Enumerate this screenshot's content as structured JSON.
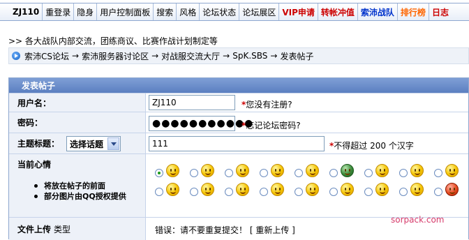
{
  "topnav": {
    "items": [
      {
        "label": "ZJ110",
        "color": "#000000"
      },
      {
        "label": "重登录",
        "color": "#000000"
      },
      {
        "label": "隐身",
        "color": "#000000"
      },
      {
        "label": "用户控制面板",
        "color": "#000000"
      },
      {
        "label": "搜索",
        "color": "#000000"
      },
      {
        "label": "风格",
        "color": "#000000"
      },
      {
        "label": "论坛状态",
        "color": "#000000"
      },
      {
        "label": "论坛展区",
        "color": "#000000"
      },
      {
        "label": "VIP申请",
        "color": "#cc0000"
      },
      {
        "label": "转帐冲值",
        "color": "#cc0000"
      },
      {
        "label": "索沛战队",
        "color": "#0033cc"
      },
      {
        "label": "排行榜",
        "color": "#ff6600"
      },
      {
        "label": "日志",
        "color": "#cc0000"
      }
    ]
  },
  "notice": ">> 各大战队内部交流，团练商议、比赛作战计划制定等",
  "breadcrumb": {
    "items": [
      "索沛CS论坛",
      "索沛服务器讨论区",
      "对战服交流大厅",
      "SpK.SBS",
      "发表帖子"
    ],
    "separator": "→"
  },
  "form": {
    "header": "发表帖子",
    "username": {
      "label": "用户名：",
      "value": "ZJ110",
      "required_mark": "*",
      "hint": "您没有注册?"
    },
    "password": {
      "label": "密码：",
      "value": "●●●●●●●●●●●",
      "required_mark": "*",
      "hint": "忘记论坛密码?"
    },
    "subject": {
      "label": "主题标题：",
      "topic_select": "选择话题",
      "value": "111",
      "required_mark": "*",
      "hint": "不得超过 200 个汉字"
    },
    "mood": {
      "label": "当前心情",
      "tips": [
        "将放在帖子的前面",
        "部分图片由QQ授权提供"
      ],
      "selected_index": 0,
      "smileys": [
        {
          "icon": "smile-face-icon",
          "color": "yellow"
        },
        {
          "icon": "shy-face-icon",
          "color": "yellow"
        },
        {
          "icon": "grin-face-icon",
          "color": "yellow"
        },
        {
          "icon": "love-face-icon",
          "color": "yellow"
        },
        {
          "icon": "tongue-face-icon",
          "color": "yellow"
        },
        {
          "icon": "army-face-icon",
          "color": "green"
        },
        {
          "icon": "surprised-face-icon",
          "color": "yellow"
        },
        {
          "icon": "sweat-face-icon",
          "color": "yellow"
        },
        {
          "icon": "wink-face-icon",
          "color": "yellow"
        },
        {
          "icon": "confused-face-icon",
          "color": "yellow"
        },
        {
          "icon": "worried-face-icon",
          "color": "yellow"
        },
        {
          "icon": "cry-face-icon",
          "color": "yellow"
        },
        {
          "icon": "scream-face-icon",
          "color": "yellow"
        },
        {
          "icon": "smirk-face-icon",
          "color": "yellow"
        },
        {
          "icon": "cool-face-icon",
          "color": "yellow"
        },
        {
          "icon": "sad-face-icon",
          "color": "yellow"
        },
        {
          "icon": "hammer-face-icon",
          "color": "yellow"
        },
        {
          "icon": "angry-face-icon",
          "color": "red"
        }
      ]
    },
    "upload": {
      "label": "文件上传",
      "sublabel": "类型",
      "message": "错误：请不要重复提交！",
      "reupload": "[ 重新上传 ]"
    }
  },
  "watermark": "sorpack.com"
}
